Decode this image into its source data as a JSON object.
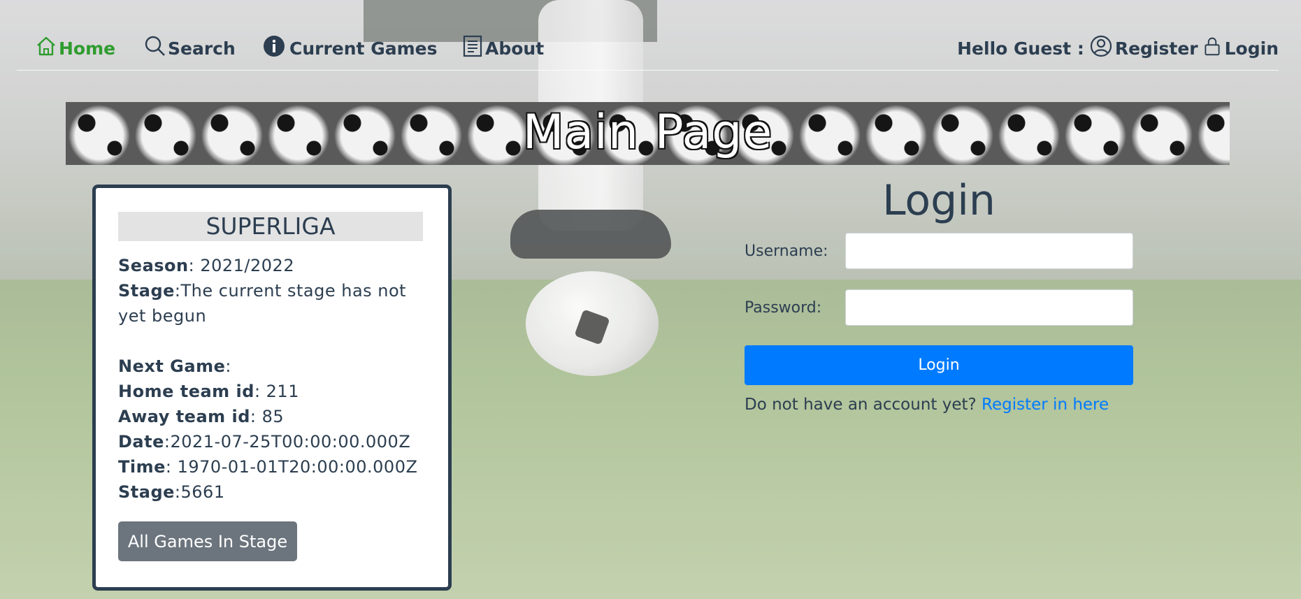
{
  "nav": {
    "home": "Home",
    "search": "Search",
    "current_games": "Current Games",
    "about": "About",
    "greeting": "Hello Guest :",
    "register": "Register",
    "login": "Login"
  },
  "banner": {
    "title": "Main Page"
  },
  "league": {
    "name": "SUPERLIGA",
    "season_label": "Season",
    "season": ": 2021/2022",
    "stage_label": "Stage",
    "stage": ":The current stage has not yet begun",
    "next_game_label": "Next Game",
    "next_game_suffix": ":",
    "home_team_label": "Home team id",
    "home_team": ": 211",
    "away_team_label": "Away team id",
    "away_team": ": 85",
    "date_label": "Date",
    "date": ":2021-07-25T00:00:00.000Z",
    "time_label": "Time",
    "time": ": 1970-01-01T20:00:00.000Z",
    "game_stage_label": "Stage",
    "game_stage": ":5661",
    "all_games_button": "All Games In Stage"
  },
  "login_form": {
    "title": "Login",
    "username_label": "Username:",
    "username_value": "",
    "password_label": "Password:",
    "password_value": "",
    "submit": "Login",
    "no_account_text": "Do not have an account yet?",
    "register_link": "Register in here"
  },
  "colors": {
    "nav_text": "#2c3e50",
    "nav_active": "#2f9c2f",
    "primary": "#007bff",
    "secondary": "#6c757d",
    "card_border": "#2c3e50"
  },
  "icons": {
    "home": "house-icon",
    "search": "search-icon",
    "current_games": "info-circle-icon",
    "about": "document-icon",
    "register": "user-circle-icon",
    "login": "lock-icon"
  }
}
